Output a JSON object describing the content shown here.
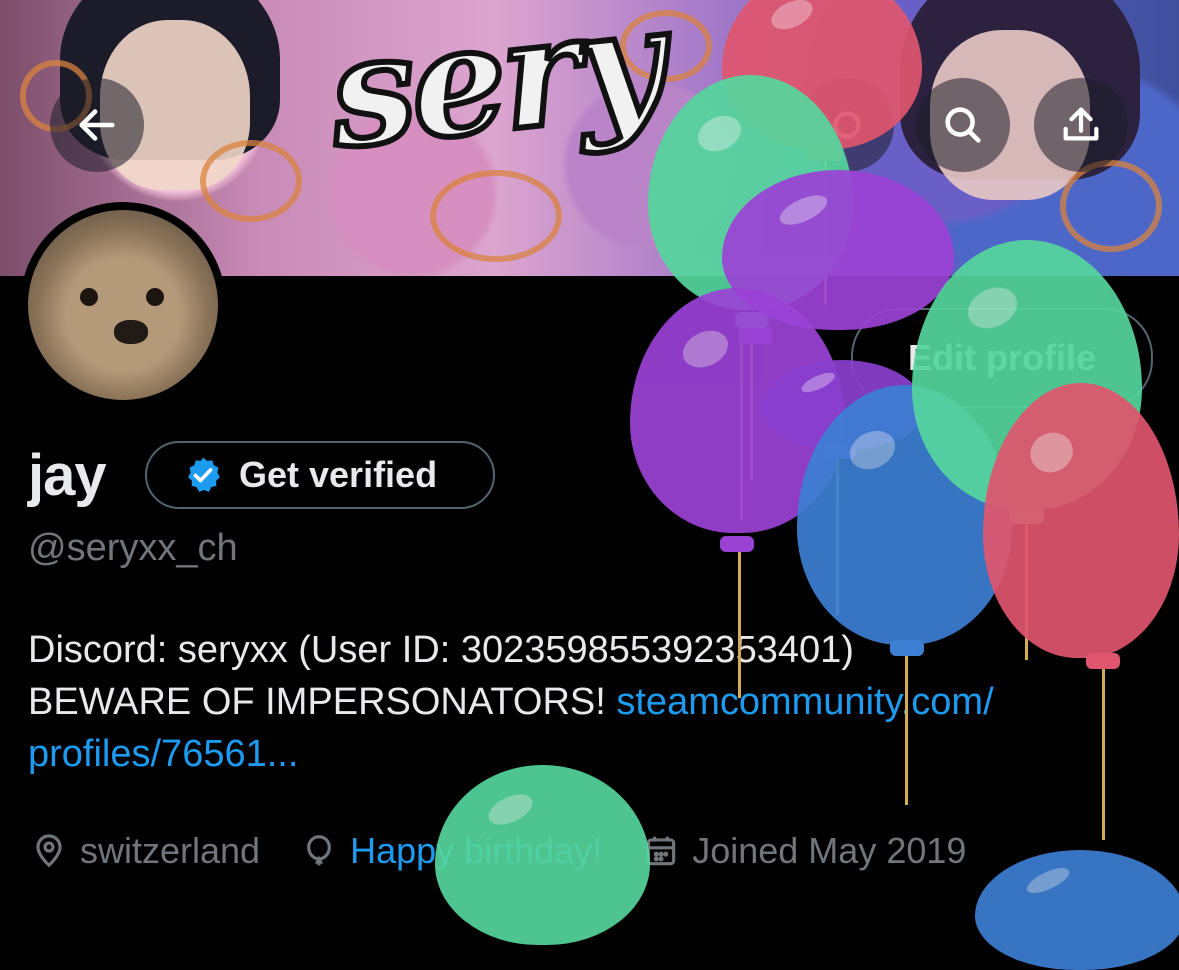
{
  "header": {
    "back_icon": "arrow-left-icon",
    "search_icon": "search-icon",
    "share_icon": "share-upload-icon"
  },
  "banner": {
    "art_text": "sery"
  },
  "profile": {
    "name": "jay",
    "verify_label": "Get verified",
    "handle": "@seryxx_ch",
    "edit_label": "Edit profile",
    "bio_line1": "Discord: seryxx (User ID: 302359855392353401)",
    "bio_line2_text": "BEWARE OF IMPERSONATORS!",
    "bio_link_part1": "steamcommunity.com/",
    "bio_link_part2": "profiles/76561...",
    "location": "switzerland",
    "birthday": "Happy birthday!",
    "joined": "Joined May 2019"
  },
  "colors": {
    "accent": "#1d9bf0",
    "secondary_text": "#71767b",
    "border": "#536471",
    "verified_badge": "#1d9bf0"
  }
}
